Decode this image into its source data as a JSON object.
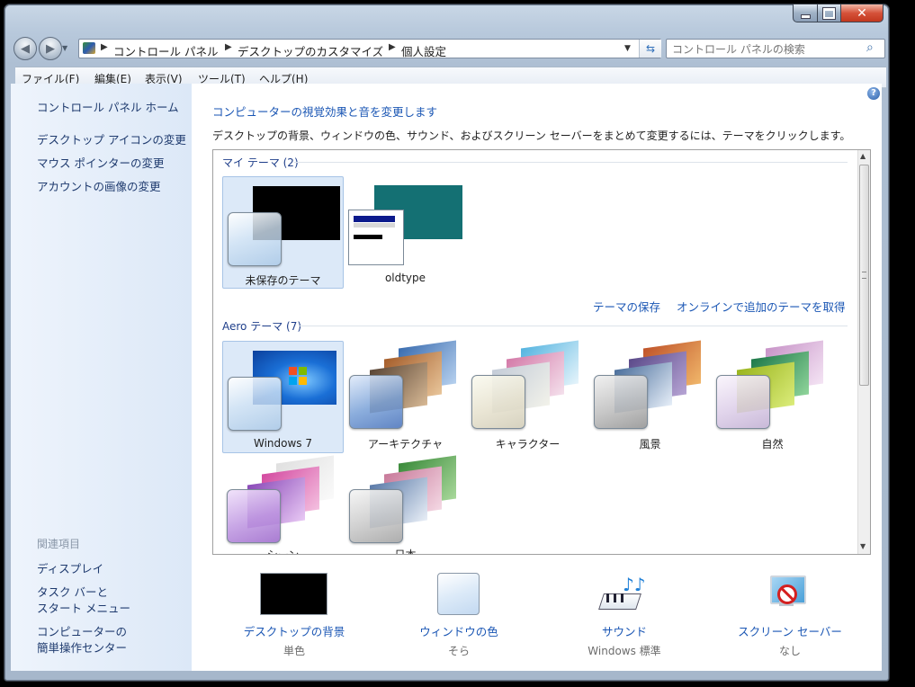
{
  "window": {
    "caption_buttons": {
      "minimize_icon": "minimize-icon",
      "maximize_icon": "maximize-icon",
      "close_icon": "close-icon"
    }
  },
  "address_bar": {
    "breadcrumbs": [
      "コントロール パネル",
      "デスクトップのカスタマイズ",
      "個人設定"
    ]
  },
  "search": {
    "placeholder": "コントロール パネルの検索"
  },
  "menu": {
    "items": [
      "ファイル(F)",
      "編集(E)",
      "表示(V)",
      "ツール(T)",
      "ヘルプ(H)"
    ]
  },
  "sidebar": {
    "home": "コントロール パネル ホーム",
    "links": [
      "デスクトップ アイコンの変更",
      "マウス ポインターの変更",
      "アカウントの画像の変更"
    ],
    "related_header": "関連項目",
    "related": [
      "ディスプレイ",
      "タスク バーと",
      "スタート メニュー",
      "コンピューターの",
      "簡単操作センター"
    ]
  },
  "main": {
    "title": "コンピューターの視覚効果と音を変更します",
    "description": "デスクトップの背景、ウィンドウの色、サウンド、およびスクリーン セーバーをまとめて変更するには、テーマをクリックします。",
    "my_themes": {
      "header": "マイ テーマ (2)",
      "themes": [
        "未保存のテーマ",
        "oldtype"
      ],
      "save_link": "テーマの保存",
      "online_link": "オンラインで追加のテーマを取得"
    },
    "aero_themes": {
      "header": "Aero テーマ (7)",
      "themes": [
        "Windows 7",
        "アーキテクチャ",
        "キャラクター",
        "風景",
        "自然",
        "シーン",
        "日本"
      ]
    },
    "bottom": [
      {
        "label": "デスクトップの背景",
        "value": "単色"
      },
      {
        "label": "ウィンドウの色",
        "value": "そら"
      },
      {
        "label": "サウンド",
        "value": "Windows 標準"
      },
      {
        "label": "スクリーン セーバー",
        "value": "なし"
      }
    ]
  },
  "colors": {
    "accent_link": "#1a56b4",
    "selected_tile": "#dce9f8",
    "oldtype_teal": "#147073"
  }
}
